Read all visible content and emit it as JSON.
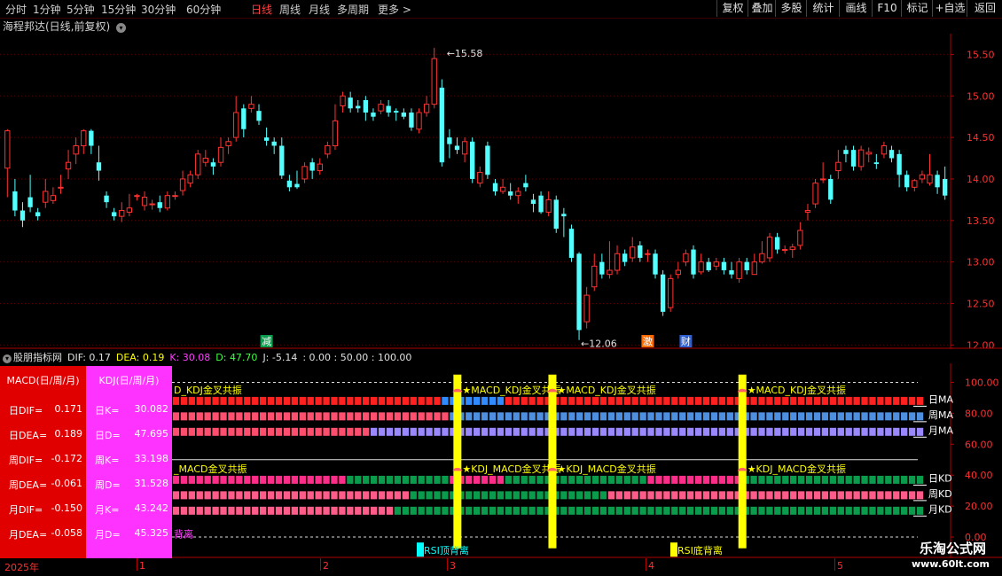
{
  "toolbar": {
    "periods": [
      "分时",
      "1分钟",
      "5分钟",
      "15分钟",
      "30分钟",
      "60分钟",
      "日线",
      "周线",
      "月线",
      "多周期",
      "更多 >"
    ],
    "active_period": "日线",
    "buttons": [
      "复权",
      "叠加",
      "多股",
      "统计",
      "画线",
      "F10",
      "标记",
      "+自选",
      "返回"
    ]
  },
  "stock": {
    "title": "海程邦达(日线,前复权)"
  },
  "chart_data": [
    {
      "type": "candlestick",
      "title": "海程邦达(日线,前复权)",
      "ylim": [
        11.95,
        15.75
      ],
      "y_ticks": [
        "15.50",
        "15.00",
        "14.50",
        "14.00",
        "13.50",
        "13.00",
        "12.50",
        "12.00"
      ],
      "x_labels": [
        "2025年",
        "1",
        "2",
        "3",
        "4",
        "5"
      ],
      "colors": {
        "up": "#ff3232",
        "down": "#54ffff"
      },
      "candles": [
        [
          14.13,
          14.58,
          14.6,
          13.78
        ],
        [
          13.85,
          13.62,
          14.0,
          13.55
        ],
        [
          13.62,
          13.5,
          13.72,
          13.42
        ],
        [
          13.78,
          13.66,
          14.05,
          13.6
        ],
        [
          13.6,
          13.55,
          13.65,
          13.5
        ],
        [
          13.72,
          13.85,
          14.0,
          13.65
        ],
        [
          13.74,
          13.8,
          13.9,
          13.7
        ],
        [
          13.9,
          13.9,
          14.05,
          13.82
        ],
        [
          14.12,
          14.2,
          14.35,
          14.0
        ],
        [
          14.3,
          14.4,
          14.5,
          14.18
        ],
        [
          14.4,
          14.58,
          14.6,
          14.3
        ],
        [
          14.58,
          14.4,
          14.6,
          14.3
        ],
        [
          14.2,
          14.1,
          14.4,
          13.98
        ],
        [
          13.8,
          13.72,
          13.85,
          13.65
        ],
        [
          13.6,
          13.55,
          13.65,
          13.5
        ],
        [
          13.55,
          13.62,
          13.72,
          13.48
        ],
        [
          13.6,
          13.65,
          13.82,
          13.55
        ],
        [
          13.8,
          13.8,
          13.82,
          13.74
        ],
        [
          13.68,
          13.78,
          13.85,
          13.62
        ],
        [
          13.7,
          13.7,
          13.75,
          13.63
        ],
        [
          13.72,
          13.65,
          13.8,
          13.6
        ],
        [
          13.65,
          13.8,
          13.85,
          13.62
        ],
        [
          13.8,
          13.8,
          13.85,
          13.75
        ],
        [
          13.86,
          14.0,
          14.1,
          13.8
        ],
        [
          13.95,
          14.05,
          14.1,
          13.9
        ],
        [
          14.05,
          14.3,
          14.35,
          14.0
        ],
        [
          14.2,
          14.25,
          14.35,
          14.15
        ],
        [
          14.2,
          14.15,
          14.25,
          14.05
        ],
        [
          14.2,
          14.38,
          14.5,
          14.15
        ],
        [
          14.4,
          14.45,
          14.5,
          14.3
        ],
        [
          14.5,
          14.8,
          15.0,
          14.45
        ],
        [
          14.85,
          14.6,
          14.9,
          14.5
        ],
        [
          14.85,
          14.9,
          15.0,
          14.8
        ],
        [
          14.82,
          14.7,
          14.9,
          14.65
        ],
        [
          14.5,
          14.46,
          14.62,
          14.4
        ],
        [
          14.45,
          14.4,
          14.5,
          14.3
        ],
        [
          14.4,
          14.04,
          14.5,
          14.0
        ],
        [
          13.98,
          13.9,
          14.05,
          13.85
        ],
        [
          13.94,
          13.9,
          14.1,
          13.88
        ],
        [
          14.0,
          14.15,
          14.2,
          13.95
        ],
        [
          14.2,
          14.1,
          14.25,
          14.0
        ],
        [
          14.1,
          14.18,
          14.25,
          14.05
        ],
        [
          14.3,
          14.4,
          14.45,
          14.25
        ],
        [
          14.4,
          14.7,
          14.9,
          14.35
        ],
        [
          14.88,
          15.0,
          15.05,
          14.8
        ],
        [
          14.98,
          14.85,
          15.05,
          14.8
        ],
        [
          14.88,
          14.85,
          14.95,
          14.8
        ],
        [
          14.95,
          14.8,
          15.0,
          14.7
        ],
        [
          14.8,
          14.75,
          14.85,
          14.7
        ],
        [
          14.82,
          14.9,
          14.95,
          14.78
        ],
        [
          14.88,
          14.8,
          14.95,
          14.75
        ],
        [
          14.82,
          14.8,
          14.85,
          14.7
        ],
        [
          14.8,
          14.75,
          14.85,
          14.72
        ],
        [
          14.8,
          14.62,
          14.85,
          14.58
        ],
        [
          14.6,
          14.8,
          14.85,
          14.55
        ],
        [
          14.8,
          14.9,
          15.0,
          14.75
        ],
        [
          14.9,
          15.45,
          15.58,
          14.85
        ],
        [
          15.1,
          14.2,
          15.2,
          14.15
        ],
        [
          14.5,
          14.42,
          14.6,
          14.25
        ],
        [
          14.4,
          14.35,
          14.5,
          14.3
        ],
        [
          14.3,
          14.45,
          14.5,
          14.2
        ],
        [
          14.45,
          14.0,
          14.5,
          13.95
        ],
        [
          13.95,
          14.08,
          14.15,
          13.9
        ],
        [
          14.4,
          14.05,
          14.45,
          14.0
        ],
        [
          13.95,
          13.85,
          14.0,
          13.8
        ],
        [
          13.85,
          13.9,
          14.0,
          13.82
        ],
        [
          13.85,
          13.8,
          13.95,
          13.75
        ],
        [
          13.8,
          13.85,
          13.9,
          13.7
        ],
        [
          13.95,
          13.9,
          14.05,
          13.85
        ],
        [
          13.75,
          13.7,
          13.82,
          13.6
        ],
        [
          13.8,
          13.6,
          13.85,
          13.58
        ],
        [
          13.6,
          13.75,
          13.85,
          13.55
        ],
        [
          13.75,
          13.4,
          13.8,
          13.35
        ],
        [
          13.58,
          13.55,
          13.65,
          13.3
        ],
        [
          13.4,
          13.05,
          13.45,
          13.0
        ],
        [
          13.1,
          12.18,
          13.12,
          12.06
        ],
        [
          12.28,
          12.6,
          12.7,
          12.2
        ],
        [
          12.7,
          12.95,
          13.1,
          12.65
        ],
        [
          13.0,
          12.85,
          13.1,
          12.8
        ],
        [
          12.85,
          12.9,
          13.25,
          12.8
        ],
        [
          12.9,
          13.1,
          13.2,
          12.85
        ],
        [
          13.1,
          13.0,
          13.15,
          12.95
        ],
        [
          13.05,
          13.18,
          13.3,
          13.0
        ],
        [
          13.2,
          13.05,
          13.25,
          13.0
        ],
        [
          13.1,
          13.1,
          13.15,
          13.0
        ],
        [
          13.1,
          12.85,
          13.15,
          12.8
        ],
        [
          12.85,
          12.4,
          12.9,
          12.35
        ],
        [
          12.45,
          12.8,
          12.85,
          12.4
        ],
        [
          12.85,
          12.9,
          13.0,
          12.8
        ],
        [
          13.0,
          13.1,
          13.15,
          12.95
        ],
        [
          13.15,
          12.85,
          13.2,
          12.8
        ],
        [
          12.88,
          13.0,
          13.1,
          12.85
        ],
        [
          13.0,
          12.9,
          13.05,
          12.88
        ],
        [
          12.95,
          13.0,
          13.05,
          12.9
        ],
        [
          13.0,
          12.9,
          13.05,
          12.85
        ],
        [
          12.9,
          12.85,
          13.0,
          12.8
        ],
        [
          12.8,
          13.0,
          13.05,
          12.75
        ],
        [
          13.0,
          12.9,
          13.05,
          12.85
        ],
        [
          12.85,
          13.0,
          13.1,
          12.85
        ],
        [
          13.0,
          13.1,
          13.25,
          12.98
        ],
        [
          13.05,
          13.3,
          13.35,
          13.0
        ],
        [
          13.3,
          13.15,
          13.35,
          13.1
        ],
        [
          13.15,
          13.15,
          13.2,
          13.1
        ],
        [
          13.15,
          13.18,
          13.22,
          13.05
        ],
        [
          13.2,
          13.38,
          13.48,
          13.15
        ],
        [
          13.6,
          13.62,
          13.7,
          13.5
        ],
        [
          13.7,
          13.95,
          14.0,
          13.65
        ],
        [
          14.0,
          14.0,
          14.2,
          13.95
        ],
        [
          14.0,
          13.75,
          14.05,
          13.7
        ],
        [
          14.1,
          14.2,
          14.35,
          14.0
        ],
        [
          14.35,
          14.3,
          14.4,
          14.2
        ],
        [
          14.35,
          14.15,
          14.4,
          14.1
        ],
        [
          14.15,
          14.35,
          14.4,
          14.1
        ],
        [
          14.3,
          14.32,
          14.38,
          14.2
        ],
        [
          14.2,
          14.18,
          14.3,
          14.12
        ],
        [
          14.3,
          14.4,
          14.45,
          14.25
        ],
        [
          14.35,
          14.25,
          14.4,
          14.2
        ],
        [
          14.3,
          14.05,
          14.35,
          13.9
        ],
        [
          14.05,
          13.9,
          14.1,
          13.85
        ],
        [
          13.9,
          13.98,
          14.0,
          13.85
        ],
        [
          14.0,
          14.05,
          14.1,
          13.95
        ],
        [
          13.95,
          14.05,
          14.3,
          13.92
        ],
        [
          14.05,
          13.9,
          14.1,
          13.82
        ],
        [
          14.0,
          13.8,
          14.15,
          13.75
        ]
      ],
      "annotations": {
        "high": "15.58",
        "low": "12.06"
      },
      "markers": [
        "减",
        "激",
        "财"
      ]
    },
    {
      "type": "indicator",
      "title": "股朋指标网",
      "readout": {
        "dif": "DIF: 0.17",
        "dea": "DEA: 0.19",
        "k": "K: 30.08",
        "d": "D: 47.70",
        "j": "J: -5.14",
        "rest": ": 0.00  : 50.00  : 100.00"
      },
      "ylim": [
        0,
        110
      ],
      "y_ticks": [
        "100.00",
        "80.00",
        "60.00",
        "40.00",
        "20.00",
        "0.00"
      ],
      "row_labels": [
        "日MA",
        "周MA",
        "月MA",
        "日KD",
        "周KD",
        "月KD"
      ],
      "signal_labels": [
        "★MACD_KDJ金叉共振",
        "★KDJ_MACD金叉共振"
      ],
      "partial_labels": [
        "D_KDJ金叉共振",
        "_MACD金叉共振",
        "背离"
      ],
      "divergence_labels": [
        "RSI顶背离",
        "RSI底背离"
      ],
      "rows": [
        {
          "name": "日MACD",
          "y": 88,
          "segments": [
            [
              0,
              34,
              "#ff2020"
            ],
            [
              34,
              42,
              "#2f8bff"
            ],
            [
              42,
              95,
              "#ff2020"
            ]
          ]
        },
        {
          "name": "周MACD",
          "y": 78,
          "segments": [
            [
              0,
              35,
              "#ff5070"
            ],
            [
              35,
              95,
              "#4f8fe0"
            ]
          ]
        },
        {
          "name": "月MACD",
          "y": 68,
          "segments": [
            [
              0,
              25,
              "#ff4d6d"
            ],
            [
              25,
              95,
              "#9a88ff"
            ]
          ]
        },
        {
          "name": "日KDJ",
          "y": 37,
          "segments": [
            [
              0,
              22,
              "#ff2d8a"
            ],
            [
              22,
              35,
              "#0a9c4c"
            ],
            [
              35,
              42,
              "#ff2d8a"
            ],
            [
              42,
              60,
              "#0a9c4c"
            ],
            [
              60,
              72,
              "#ff2d8a"
            ],
            [
              72,
              95,
              "#0a9c4c"
            ]
          ]
        },
        {
          "name": "周KDJ",
          "y": 27,
          "segments": [
            [
              0,
              30,
              "#ff5c8a"
            ],
            [
              30,
              55,
              "#0a9c4c"
            ],
            [
              55,
              95,
              "#ff5c8a"
            ]
          ]
        },
        {
          "name": "月KDJ",
          "y": 17,
          "segments": [
            [
              0,
              28,
              "#ff5c8a"
            ],
            [
              28,
              95,
              "#0a9c4c"
            ]
          ]
        }
      ],
      "signal_days": [
        36,
        48,
        72
      ]
    }
  ],
  "macd_panel": {
    "header": "MACD(日/周/月)",
    "rows": [
      {
        "label": "日DIF=",
        "value": "0.171"
      },
      {
        "label": "日DEA=",
        "value": "0.189"
      },
      {
        "label": "周DIF=",
        "value": "-0.172"
      },
      {
        "label": "周DEA=",
        "value": "-0.061"
      },
      {
        "label": "月DIF=",
        "value": "-0.150"
      },
      {
        "label": "月DEA=",
        "value": "-0.058"
      }
    ]
  },
  "kdj_panel": {
    "header": "KDJ(日/周/月)",
    "rows": [
      {
        "label": "日K=",
        "value": "30.082"
      },
      {
        "label": "日D=",
        "value": "47.695"
      },
      {
        "label": "周K=",
        "value": "33.198"
      },
      {
        "label": "周D=",
        "value": "31.528"
      },
      {
        "label": "月K=",
        "value": "43.242"
      },
      {
        "label": "月D=",
        "value": "45.325"
      }
    ]
  },
  "watermark": {
    "line1": "乐淘公式网",
    "line2": "www.60lt.com"
  },
  "colors": {
    "grid": "#5a0000",
    "axis": "#b00000"
  }
}
